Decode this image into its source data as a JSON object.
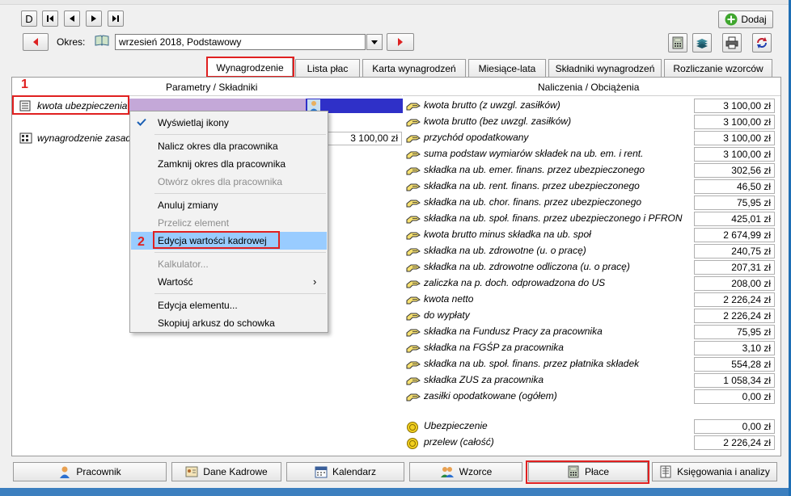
{
  "nav": {
    "first": "D",
    "period_label": "Okres:",
    "period_value": "wrzesień 2018, Podstawowy",
    "add_label": "Dodaj"
  },
  "tabs": [
    {
      "label": "Wynagrodzenie"
    },
    {
      "label": "Lista płac"
    },
    {
      "label": "Karta wynagrodzeń"
    },
    {
      "label": "Miesiące-lata"
    },
    {
      "label": "Składniki wynagrodzeń"
    },
    {
      "label": "Rozliczanie wzorców"
    }
  ],
  "left": {
    "header": "Parametry / Składniki",
    "rows": [
      {
        "label": "kwota ubezpieczenia"
      },
      {
        "label": "wynagrodzenie zasad",
        "value": "3 100,00 zł"
      }
    ]
  },
  "right": {
    "header": "Naliczenia / Obciążenia",
    "rows": [
      {
        "label": "kwota brutto (z uwzgl. zasiłków)",
        "value": "3 100,00 zł"
      },
      {
        "label": "kwota brutto (bez uwzgl. zasiłków)",
        "value": "3 100,00 zł"
      },
      {
        "label": "przychód opodatkowany",
        "value": "3 100,00 zł"
      },
      {
        "label": "suma podstaw wymiarów składek na ub. em. i rent.",
        "value": "3 100,00 zł"
      },
      {
        "label": "składka na ub. emer. finans. przez ubezpieczonego",
        "value": "302,56 zł"
      },
      {
        "label": "składka na ub. rent. finans. przez ubezpieczonego",
        "value": "46,50 zł"
      },
      {
        "label": "składka na ub. chor. finans. przez ubezpieczonego",
        "value": "75,95 zł"
      },
      {
        "label": "składka na ub. społ. finans. przez ubezpieczonego i PFRON",
        "value": "425,01 zł"
      },
      {
        "label": "kwota brutto minus składka na ub. społ",
        "value": "2 674,99 zł"
      },
      {
        "label": "składka na ub. zdrowotne (u. o pracę)",
        "value": "240,75 zł"
      },
      {
        "label": "składka na ub. zdrowotne odliczona (u. o pracę)",
        "value": "207,31 zł"
      },
      {
        "label": "zaliczka na p. doch. odprowadzona do US",
        "value": "208,00 zł"
      },
      {
        "label": "kwota netto",
        "value": "2 226,24 zł"
      },
      {
        "label": "do wypłaty",
        "value": "2 226,24 zł"
      },
      {
        "label": "składka na Fundusz Pracy za pracownika",
        "value": "75,95 zł"
      },
      {
        "label": "składka na FGŚP za pracownika",
        "value": "3,10 zł"
      },
      {
        "label": "składka na ub. społ. finans. przez płatnika składek",
        "value": "554,28 zł"
      },
      {
        "label": "składka ZUS za pracownika",
        "value": "1 058,34 zł"
      },
      {
        "label": "zasiłki opodatkowane (ogółem)",
        "value": "0,00 zł"
      }
    ],
    "extra": [
      {
        "label": "Ubezpieczenie",
        "value": "0,00 zł"
      },
      {
        "label": "przelew (całość)",
        "value": "2 226,24 zł"
      }
    ]
  },
  "context_menu": {
    "items": [
      {
        "label": "Wyświetlaj ikony"
      },
      {
        "label": "Nalicz okres dla pracownika"
      },
      {
        "label": "Zamknij okres dla pracownika"
      },
      {
        "label": "Otwórz okres dla pracownika"
      },
      {
        "label": "Anuluj zmiany"
      },
      {
        "label": "Przelicz element"
      },
      {
        "label": "Edycja wartości kadrowej"
      },
      {
        "label": "Kalkulator..."
      },
      {
        "label": "Wartość"
      },
      {
        "label": "Edycja elementu..."
      },
      {
        "label": "Skopiuj arkusz do schowka"
      }
    ]
  },
  "markers": {
    "one": "1",
    "two": "2"
  },
  "bottom": [
    {
      "label": "Pracownik"
    },
    {
      "label": "Dane Kadrowe"
    },
    {
      "label": "Kalendarz"
    },
    {
      "label": "Wzorce"
    },
    {
      "label": "Płace"
    },
    {
      "label": "Księgowania i analizy"
    }
  ],
  "colors": {
    "accent_red": "#e02020",
    "highlight": "#99ccff",
    "purple": "#c4a8d8",
    "blue": "#2f30c8"
  }
}
